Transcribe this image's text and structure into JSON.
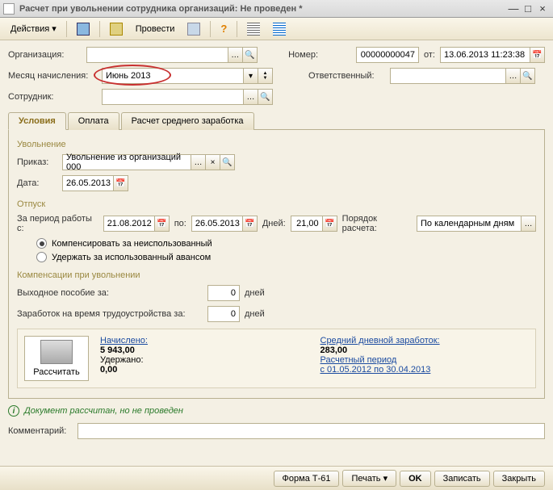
{
  "window": {
    "title": "Расчет при увольнении сотрудника организаций: Не проведен *"
  },
  "toolbar": {
    "actions": "Действия",
    "post": "Провести"
  },
  "header": {
    "org_lbl": "Организация:",
    "org_val": "",
    "num_lbl": "Номер:",
    "num_val": "00000000047",
    "from_lbl": "от:",
    "date_val": "13.06.2013 11:23:38",
    "month_lbl": "Месяц начисления:",
    "month_val": "Июнь 2013",
    "resp_lbl": "Ответственный:",
    "resp_val": "",
    "emp_lbl": "Сотрудник:",
    "emp_val": ""
  },
  "tabs": {
    "t1": "Условия",
    "t2": "Оплата",
    "t3": "Расчет среднего заработка"
  },
  "dismissal": {
    "grp": "Увольнение",
    "order_lbl": "Приказ:",
    "order_val": "Увольнение из организаций 000",
    "date_lbl": "Дата:",
    "date_val": "26.05.2013"
  },
  "vacation": {
    "grp": "Отпуск",
    "period_lbl": "За период работы с:",
    "from": "21.08.2012",
    "to_lbl": "по:",
    "to": "26.05.2013",
    "days_lbl": "Дней:",
    "days": "21,00",
    "calc_lbl": "Порядок расчета:",
    "calc_val": "По календарным дням",
    "r1": "Компенсировать за неиспользованный",
    "r2": "Удержать за использованный авансом"
  },
  "comp": {
    "grp": "Компенсации при увольнении",
    "sev_lbl": "Выходное пособие за:",
    "sev_val": "0",
    "days": "дней",
    "earn_lbl": "Заработок на время трудоустройства за:",
    "earn_val": "0"
  },
  "calc": {
    "btn": "Рассчитать",
    "accrued_lbl": "Начислено:",
    "accrued": "5 943,00",
    "withheld_lbl": "Удержано:",
    "withheld": "0,00",
    "avg_lbl": "Средний дневной заработок:",
    "avg": "283,00",
    "period_lbl": "Расчетный период",
    "period": "с 01.05.2012 по 30.04.2013"
  },
  "status": "Документ рассчитан, но не проведен",
  "comment_lbl": "Комментарий:",
  "footer": {
    "t61": "Форма Т-61",
    "print": "Печать",
    "ok": "OK",
    "save": "Записать",
    "close": "Закрыть"
  }
}
